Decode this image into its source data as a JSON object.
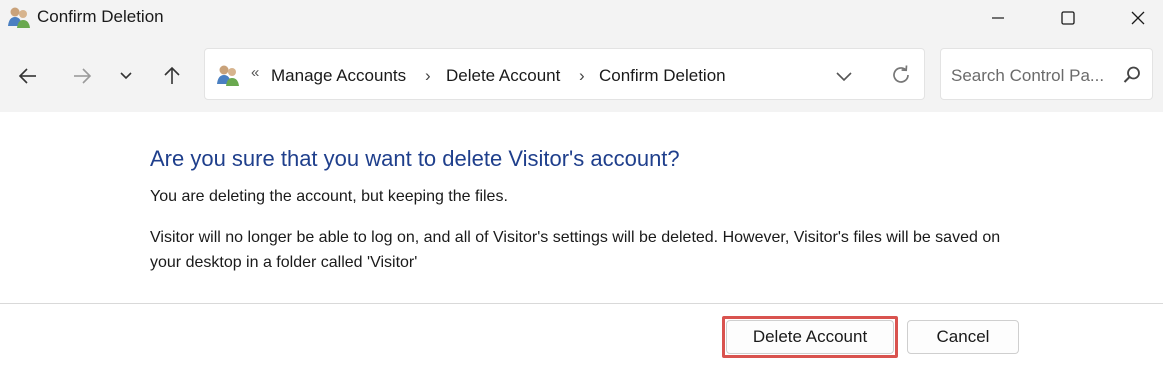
{
  "window": {
    "title": "Confirm Deletion",
    "app_icon": "user-accounts-icon"
  },
  "nav": {
    "back_icon": "arrow-left-icon",
    "forward_icon": "arrow-right-icon",
    "recent_icon": "chevron-down-icon",
    "up_icon": "arrow-up-icon"
  },
  "address": {
    "overflow": "«",
    "breadcrumbs": [
      "Manage Accounts",
      "Delete Account",
      "Confirm Deletion"
    ],
    "separator": "›"
  },
  "search": {
    "placeholder": "Search Control Pa..."
  },
  "content": {
    "heading": "Are you sure that you want to delete Visitor's account?",
    "paragraph1": "You are deleting the account, but keeping the files.",
    "paragraph2": "Visitor will no longer be able to log on, and all of Visitor's settings will be deleted. However, Visitor's files will be saved on your desktop in a folder called 'Visitor'"
  },
  "buttons": {
    "delete_label": "Delete Account",
    "cancel_label": "Cancel"
  },
  "colors": {
    "heading": "#1f3f8c",
    "highlight": "#d9534f",
    "chrome_bg": "#f3f3f3"
  }
}
